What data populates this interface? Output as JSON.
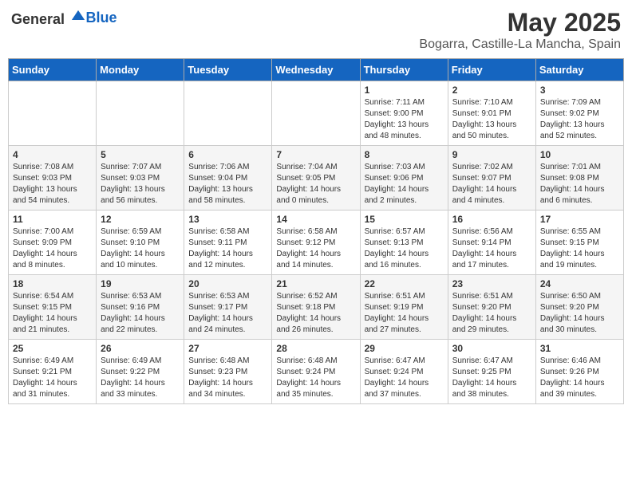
{
  "header": {
    "logo_general": "General",
    "logo_blue": "Blue",
    "title": "May 2025",
    "subtitle": "Bogarra, Castille-La Mancha, Spain"
  },
  "weekdays": [
    "Sunday",
    "Monday",
    "Tuesday",
    "Wednesday",
    "Thursday",
    "Friday",
    "Saturday"
  ],
  "weeks": [
    [
      {
        "day": "",
        "info": ""
      },
      {
        "day": "",
        "info": ""
      },
      {
        "day": "",
        "info": ""
      },
      {
        "day": "",
        "info": ""
      },
      {
        "day": "1",
        "info": "Sunrise: 7:11 AM\nSunset: 9:00 PM\nDaylight: 13 hours\nand 48 minutes."
      },
      {
        "day": "2",
        "info": "Sunrise: 7:10 AM\nSunset: 9:01 PM\nDaylight: 13 hours\nand 50 minutes."
      },
      {
        "day": "3",
        "info": "Sunrise: 7:09 AM\nSunset: 9:02 PM\nDaylight: 13 hours\nand 52 minutes."
      }
    ],
    [
      {
        "day": "4",
        "info": "Sunrise: 7:08 AM\nSunset: 9:03 PM\nDaylight: 13 hours\nand 54 minutes."
      },
      {
        "day": "5",
        "info": "Sunrise: 7:07 AM\nSunset: 9:03 PM\nDaylight: 13 hours\nand 56 minutes."
      },
      {
        "day": "6",
        "info": "Sunrise: 7:06 AM\nSunset: 9:04 PM\nDaylight: 13 hours\nand 58 minutes."
      },
      {
        "day": "7",
        "info": "Sunrise: 7:04 AM\nSunset: 9:05 PM\nDaylight: 14 hours\nand 0 minutes."
      },
      {
        "day": "8",
        "info": "Sunrise: 7:03 AM\nSunset: 9:06 PM\nDaylight: 14 hours\nand 2 minutes."
      },
      {
        "day": "9",
        "info": "Sunrise: 7:02 AM\nSunset: 9:07 PM\nDaylight: 14 hours\nand 4 minutes."
      },
      {
        "day": "10",
        "info": "Sunrise: 7:01 AM\nSunset: 9:08 PM\nDaylight: 14 hours\nand 6 minutes."
      }
    ],
    [
      {
        "day": "11",
        "info": "Sunrise: 7:00 AM\nSunset: 9:09 PM\nDaylight: 14 hours\nand 8 minutes."
      },
      {
        "day": "12",
        "info": "Sunrise: 6:59 AM\nSunset: 9:10 PM\nDaylight: 14 hours\nand 10 minutes."
      },
      {
        "day": "13",
        "info": "Sunrise: 6:58 AM\nSunset: 9:11 PM\nDaylight: 14 hours\nand 12 minutes."
      },
      {
        "day": "14",
        "info": "Sunrise: 6:58 AM\nSunset: 9:12 PM\nDaylight: 14 hours\nand 14 minutes."
      },
      {
        "day": "15",
        "info": "Sunrise: 6:57 AM\nSunset: 9:13 PM\nDaylight: 14 hours\nand 16 minutes."
      },
      {
        "day": "16",
        "info": "Sunrise: 6:56 AM\nSunset: 9:14 PM\nDaylight: 14 hours\nand 17 minutes."
      },
      {
        "day": "17",
        "info": "Sunrise: 6:55 AM\nSunset: 9:15 PM\nDaylight: 14 hours\nand 19 minutes."
      }
    ],
    [
      {
        "day": "18",
        "info": "Sunrise: 6:54 AM\nSunset: 9:15 PM\nDaylight: 14 hours\nand 21 minutes."
      },
      {
        "day": "19",
        "info": "Sunrise: 6:53 AM\nSunset: 9:16 PM\nDaylight: 14 hours\nand 22 minutes."
      },
      {
        "day": "20",
        "info": "Sunrise: 6:53 AM\nSunset: 9:17 PM\nDaylight: 14 hours\nand 24 minutes."
      },
      {
        "day": "21",
        "info": "Sunrise: 6:52 AM\nSunset: 9:18 PM\nDaylight: 14 hours\nand 26 minutes."
      },
      {
        "day": "22",
        "info": "Sunrise: 6:51 AM\nSunset: 9:19 PM\nDaylight: 14 hours\nand 27 minutes."
      },
      {
        "day": "23",
        "info": "Sunrise: 6:51 AM\nSunset: 9:20 PM\nDaylight: 14 hours\nand 29 minutes."
      },
      {
        "day": "24",
        "info": "Sunrise: 6:50 AM\nSunset: 9:20 PM\nDaylight: 14 hours\nand 30 minutes."
      }
    ],
    [
      {
        "day": "25",
        "info": "Sunrise: 6:49 AM\nSunset: 9:21 PM\nDaylight: 14 hours\nand 31 minutes."
      },
      {
        "day": "26",
        "info": "Sunrise: 6:49 AM\nSunset: 9:22 PM\nDaylight: 14 hours\nand 33 minutes."
      },
      {
        "day": "27",
        "info": "Sunrise: 6:48 AM\nSunset: 9:23 PM\nDaylight: 14 hours\nand 34 minutes."
      },
      {
        "day": "28",
        "info": "Sunrise: 6:48 AM\nSunset: 9:24 PM\nDaylight: 14 hours\nand 35 minutes."
      },
      {
        "day": "29",
        "info": "Sunrise: 6:47 AM\nSunset: 9:24 PM\nDaylight: 14 hours\nand 37 minutes."
      },
      {
        "day": "30",
        "info": "Sunrise: 6:47 AM\nSunset: 9:25 PM\nDaylight: 14 hours\nand 38 minutes."
      },
      {
        "day": "31",
        "info": "Sunrise: 6:46 AM\nSunset: 9:26 PM\nDaylight: 14 hours\nand 39 minutes."
      }
    ]
  ]
}
